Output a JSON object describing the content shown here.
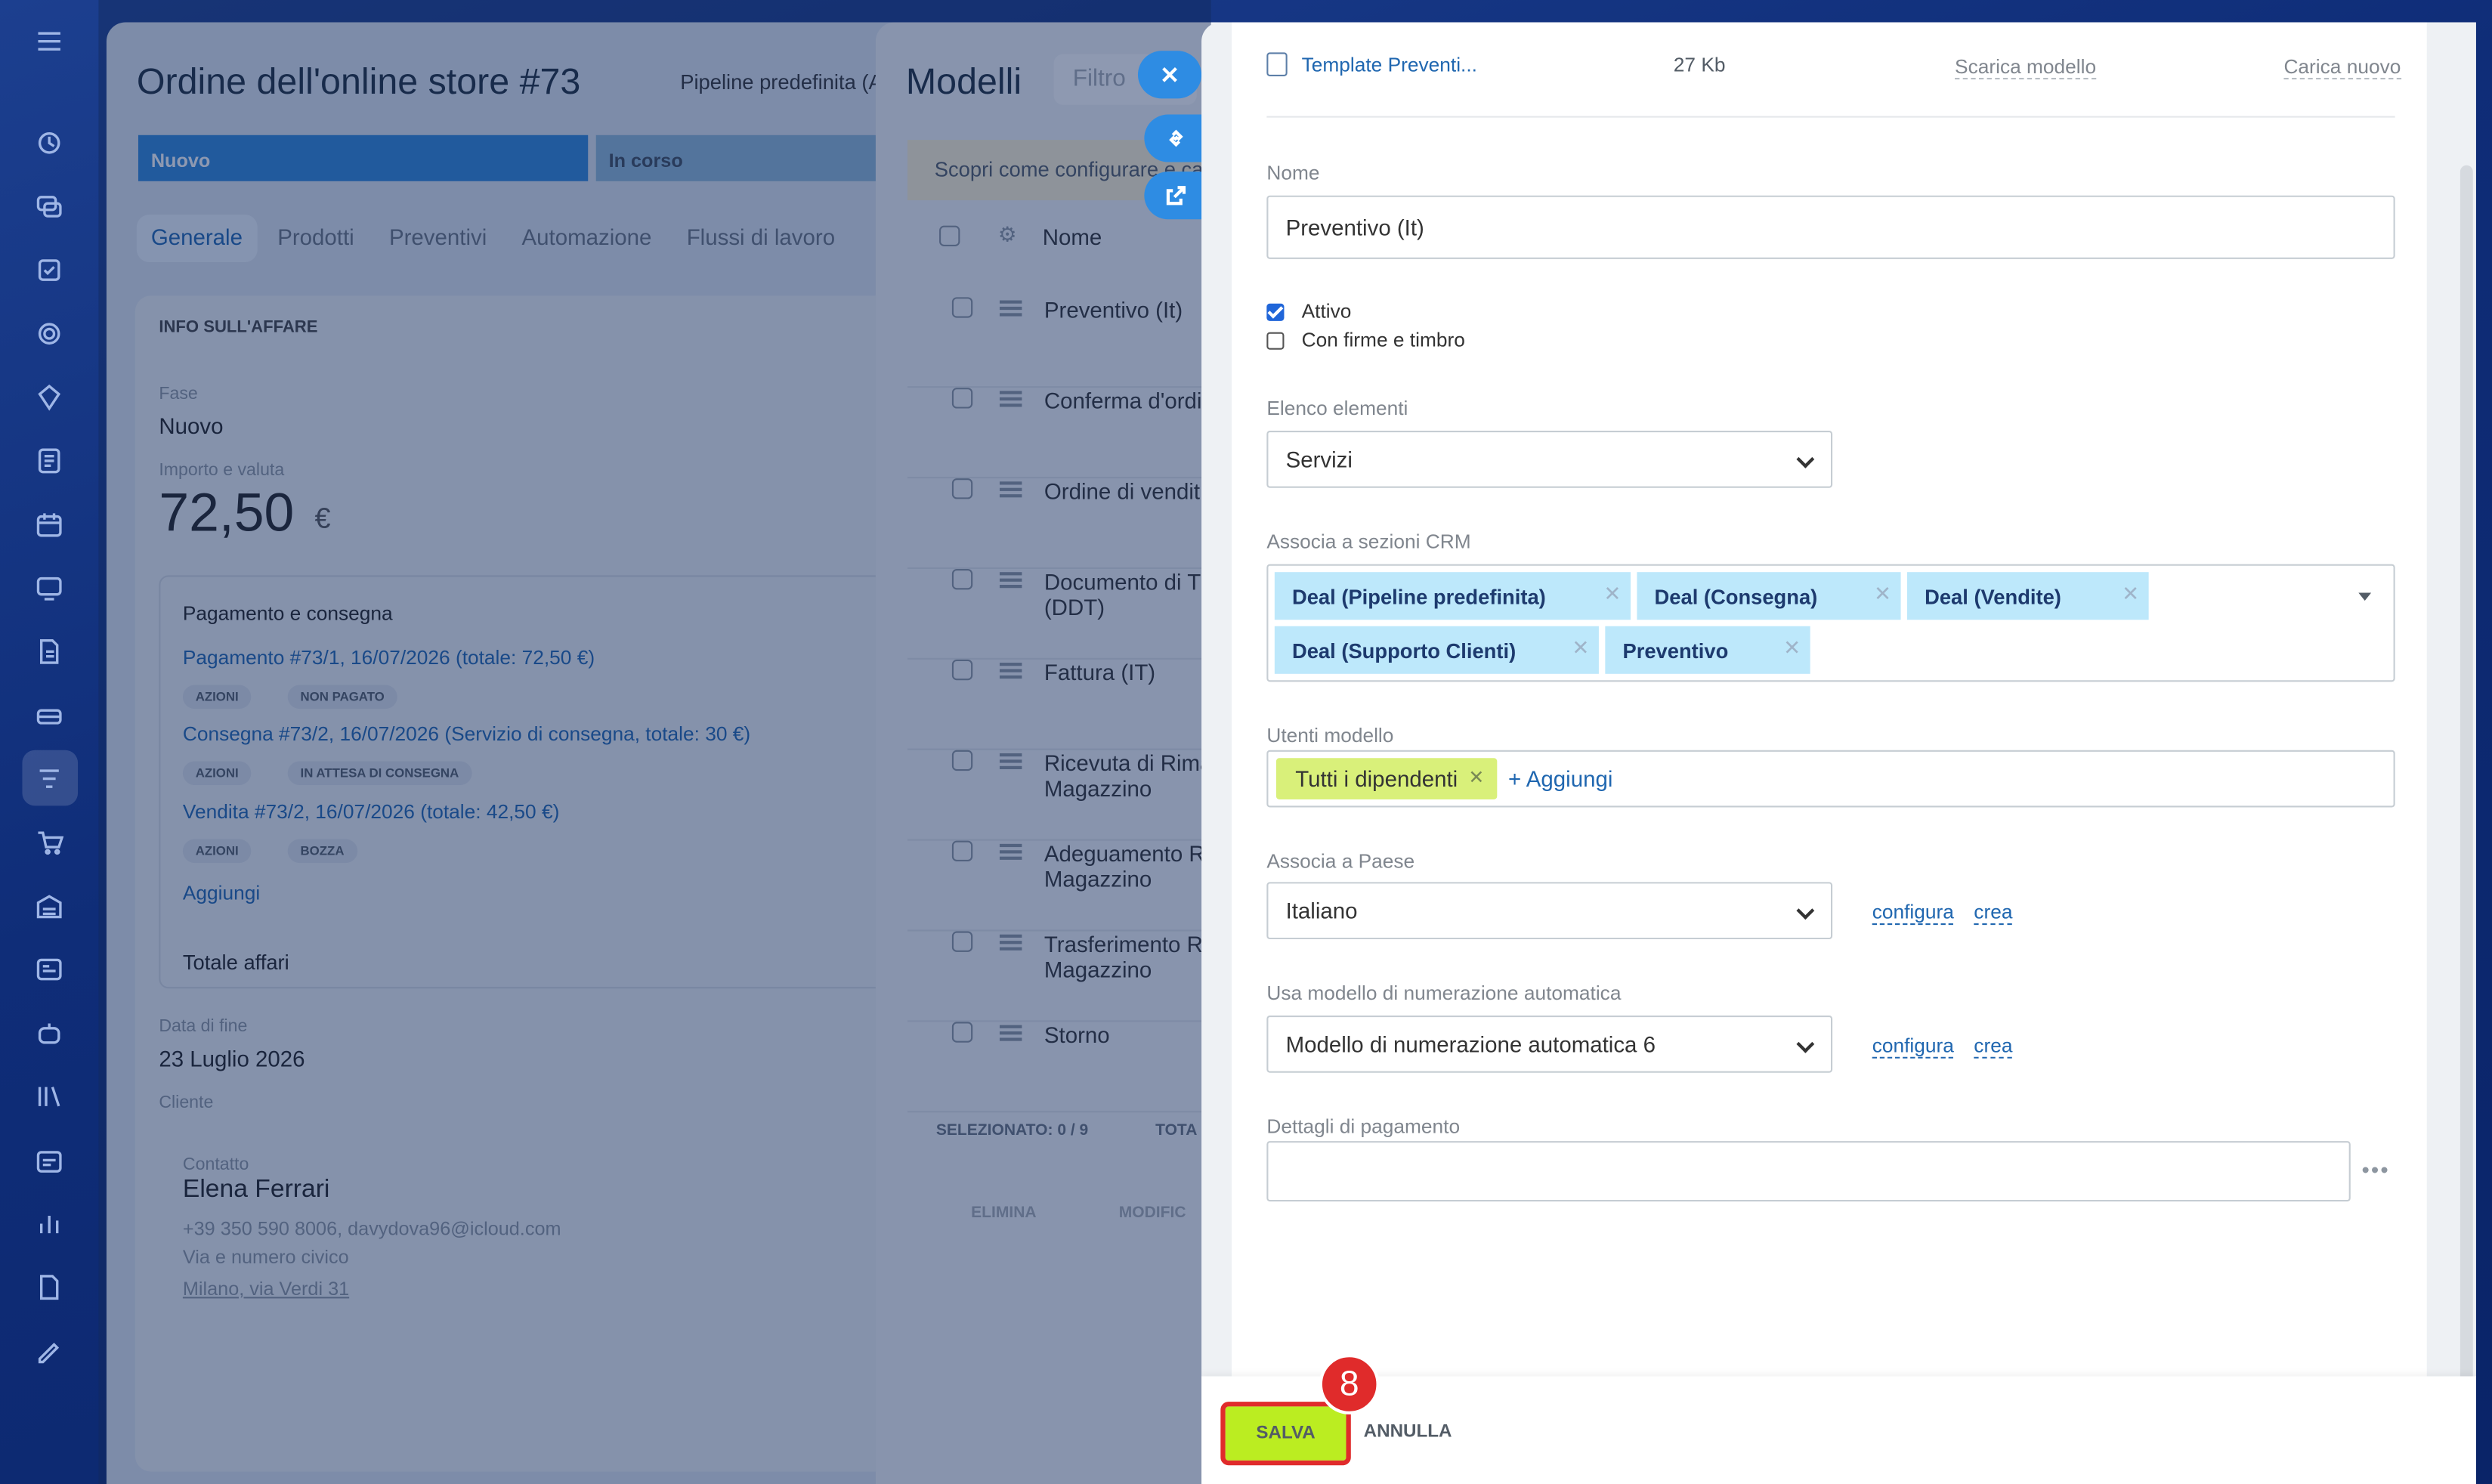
{
  "rail": {
    "icons": [
      "menu-icon",
      "activity-icon",
      "chat-icon",
      "tasks-icon",
      "sites-icon",
      "crm-icon",
      "docs-icon",
      "calendar-icon",
      "contact-center-icon",
      "invoice-icon",
      "sales-icon",
      "filter-icon",
      "shop-icon",
      "warehouse-icon",
      "cards-icon",
      "robot-icon",
      "library-icon",
      "schedule-icon",
      "analytics-icon",
      "reports-icon",
      "signature-icon"
    ]
  },
  "deal": {
    "title": "Ordine dell'online store #73",
    "pipeline": "Pipeline predefinita (A",
    "stages": [
      "Nuovo",
      "In corso"
    ],
    "tabs": [
      "Generale",
      "Prodotti",
      "Preventivi",
      "Automazione",
      "Flussi di lavoro"
    ],
    "section_title": "INFO SULL'AFFARE",
    "fase_label": "Fase",
    "fase_value": "Nuovo",
    "amount_label": "Importo e valuta",
    "amount": "72,50",
    "currency": "€",
    "payment_title": "Pagamento e consegna",
    "payments": [
      {
        "text": "Pagamento #73/1, 16/07/2026 (totale: 72,50 €)",
        "action": "AZIONI",
        "status": "NON PAGATO"
      },
      {
        "text": "Consegna #73/2, 16/07/2026 (Servizio di consegna, totale: 30 €)",
        "action": "AZIONI",
        "status": "IN ATTESA DI CONSEGNA"
      },
      {
        "text": "Vendita #73/2, 16/07/2026 (totale: 42,50 €)",
        "action": "AZIONI",
        "status": "BOZZA"
      }
    ],
    "add": "Aggiungi",
    "total_deals": "Totale affari",
    "end_label": "Data di fine",
    "end_value": "23 Luglio 2026",
    "client_label": "Cliente",
    "contact_label": "Contatto",
    "contact_name": "Elena Ferrari",
    "contact_info": "+39 350 590 8006, davydova96@icloud.com",
    "contact_street": "Via e numero civico",
    "contact_addr": "Milano, via Verdi 31"
  },
  "list": {
    "title": "Modelli",
    "filter": "Filtro",
    "hint": "Scopri come configurare e ca",
    "col_name": "Nome",
    "rows": [
      "Preventivo (It)",
      "Conferma d'ordi",
      "Ordine di vendit",
      "Documento di T\n(DDT)",
      "Fattura (IT)",
      "Ricevuta di Rima\nMagazzino",
      "Adeguamento R\nMagazzino",
      "Trasferimento R\nMagazzino",
      "Storno"
    ],
    "selected": "SELEZIONATO: 0 / 9",
    "total": "TOTA",
    "delete": "ELIMINA",
    "modify": "MODIFIC"
  },
  "form": {
    "file_name": "Template Preventi...",
    "file_size": "27 Kb",
    "download": "Scarica modello",
    "upload": "Carica nuovo",
    "name_label": "Nome",
    "name_value": "Preventivo (It)",
    "active_label": "Attivo",
    "stamp_label": "Con firme e timbro",
    "elements_label": "Elenco elementi",
    "elements_value": "Servizi",
    "crm_label": "Associa a sezioni CRM",
    "crm_tags": [
      "Deal (Pipeline predefinita)",
      "Deal (Consegna)",
      "Deal (Vendite)",
      "Deal (Supporto Clienti)",
      "Preventivo"
    ],
    "users_label": "Utenti modello",
    "users_tag": "Tutti i dipendenti",
    "users_add": "+ Aggiungi",
    "country_label": "Associa a Paese",
    "country_value": "Italiano",
    "numbering_label": "Usa modello di numerazione automatica",
    "numbering_value": "Modello di numerazione automatica 6",
    "configure": "configura",
    "create": "crea",
    "payment_label": "Dettagli di pagamento",
    "payment_value": "",
    "save": "SALVA",
    "cancel": "ANNULLA",
    "step": "8",
    "active_checked": true,
    "stamp_checked": false
  },
  "colors": {
    "save": "#bbed21",
    "highlight": "#e02b2b",
    "tag": "#bde8fb",
    "users_tag": "#d9f07a",
    "link": "#2067b0"
  }
}
